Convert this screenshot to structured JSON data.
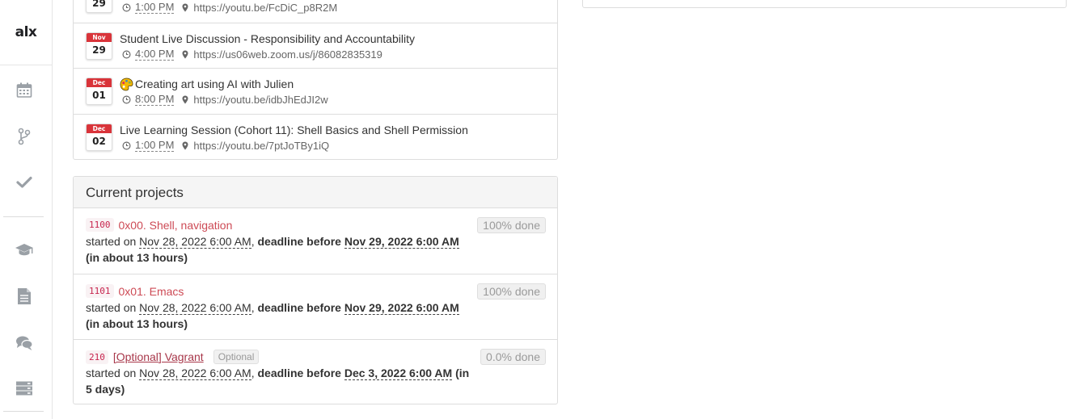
{
  "sidebar": {
    "logo": "alx",
    "icons": [
      "calendar-icon",
      "branch-icon",
      "check-icon",
      "graduation-cap-icon",
      "document-icon",
      "chat-icon",
      "server-icon"
    ]
  },
  "events": [
    {
      "month": "",
      "day": "29",
      "title": "",
      "time": "1:00 PM",
      "link": "https://youtu.be/FcDiC_p8R2M"
    },
    {
      "month": "Nov",
      "day": "29",
      "title": "Student Live Discussion - Responsibility and Accountability",
      "time": "4:00 PM",
      "link": "https://us06web.zoom.us/j/86082835319"
    },
    {
      "month": "Dec",
      "day": "01",
      "title": "Creating art using AI with Julien",
      "time": "8:00 PM",
      "link": "https://youtu.be/idbJhEdJI2w"
    },
    {
      "month": "Dec",
      "day": "02",
      "title": "Live Learning Session (Cohort 11): Shell Basics and Shell Permission",
      "time": "1:00 PM",
      "link": "https://youtu.be/7ptJoTBy1iQ"
    }
  ],
  "projects": {
    "heading": "Current projects",
    "items": [
      {
        "id": "1100",
        "name": "0x00. Shell, navigation",
        "optional": "",
        "progress": "100% done",
        "started_label": "started on ",
        "started": "Nov 28, 2022 6:00 AM",
        "deadline_label": "deadline before",
        "deadline": "Nov 29, 2022 6:00 AM",
        "remaining": "(in about 13 hours)"
      },
      {
        "id": "1101",
        "name": "0x01. Emacs",
        "optional": "",
        "progress": "100% done",
        "started_label": "started on ",
        "started": "Nov 28, 2022 6:00 AM",
        "deadline_label": "deadline before",
        "deadline": "Nov 29, 2022 6:00 AM",
        "remaining": "(in about 13 hours)"
      },
      {
        "id": "210",
        "name": "[Optional] Vagrant",
        "optional": "Optional",
        "progress": "0.0% done",
        "started_label": "started on ",
        "started": "Nov 28, 2022 6:00 AM",
        "deadline_label": "deadline before",
        "deadline": "Dec 3, 2022 6:00 AM",
        "remaining": "(in 5 days)"
      }
    ]
  },
  "colors": {
    "accent": "#d9343a",
    "link": "#cd4a55",
    "border": "#dddddd"
  }
}
